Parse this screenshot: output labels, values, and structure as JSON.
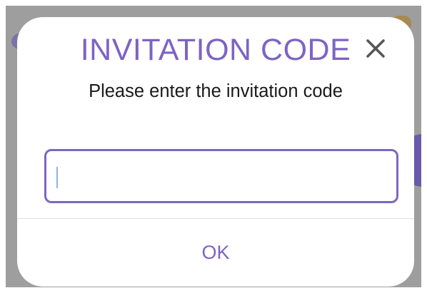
{
  "dialog": {
    "title": "INVITATION CODE",
    "close_icon": "close-icon",
    "subtitle": "Please enter the invitation code",
    "input": {
      "value": "",
      "placeholder": ""
    },
    "ok_label": "OK"
  },
  "colors": {
    "accent": "#7e63c4",
    "input_border": "#7c67c0",
    "backdrop": "#9e9e9e"
  }
}
